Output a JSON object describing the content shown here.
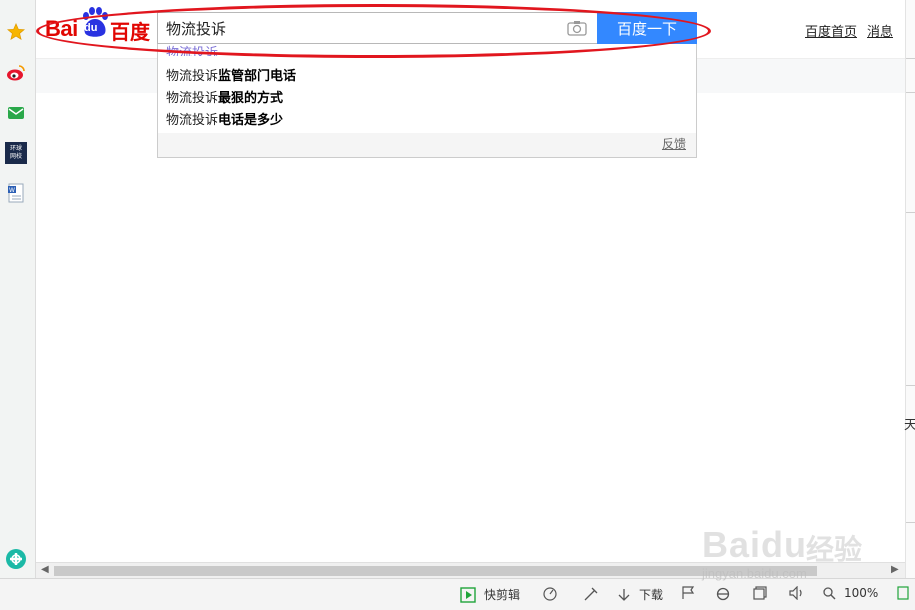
{
  "brand": {
    "logo_latin": "Bai",
    "logo_du": "du",
    "logo_cn": "百度",
    "accent": "#e10602"
  },
  "search": {
    "value": "物流投诉",
    "button_label": "百度一下",
    "button_color": "#3388ff"
  },
  "top_links": {
    "home": "百度首页",
    "messages": "消息"
  },
  "suggestions": {
    "partial_text": "物流投诉",
    "items": [
      {
        "prefix": "物流投诉",
        "suffix": "监管部门电话"
      },
      {
        "prefix": "物流投诉",
        "suffix": "最狠的方式"
      },
      {
        "prefix": "物流投诉",
        "suffix": "电话是多少"
      }
    ],
    "feedback_label": "反馈"
  },
  "sidebar": {
    "items": [
      {
        "icon": "star-icon"
      },
      {
        "icon": "weibo-icon"
      },
      {
        "icon": "mail-icon"
      },
      {
        "icon": "huanqiu-news-icon",
        "label": "环球\n网校"
      },
      {
        "icon": "word-doc-icon"
      },
      {
        "icon": "add-app-icon"
      }
    ]
  },
  "right_edge_text": "天",
  "statusbar": {
    "quick_clip": "快剪辑",
    "download": "下载",
    "zoom": "100%"
  },
  "watermark": {
    "logo": "Baidu",
    "cn": "经验",
    "url": "jingyan.baidu.com"
  },
  "annotation": {
    "color": "#e1161e"
  }
}
